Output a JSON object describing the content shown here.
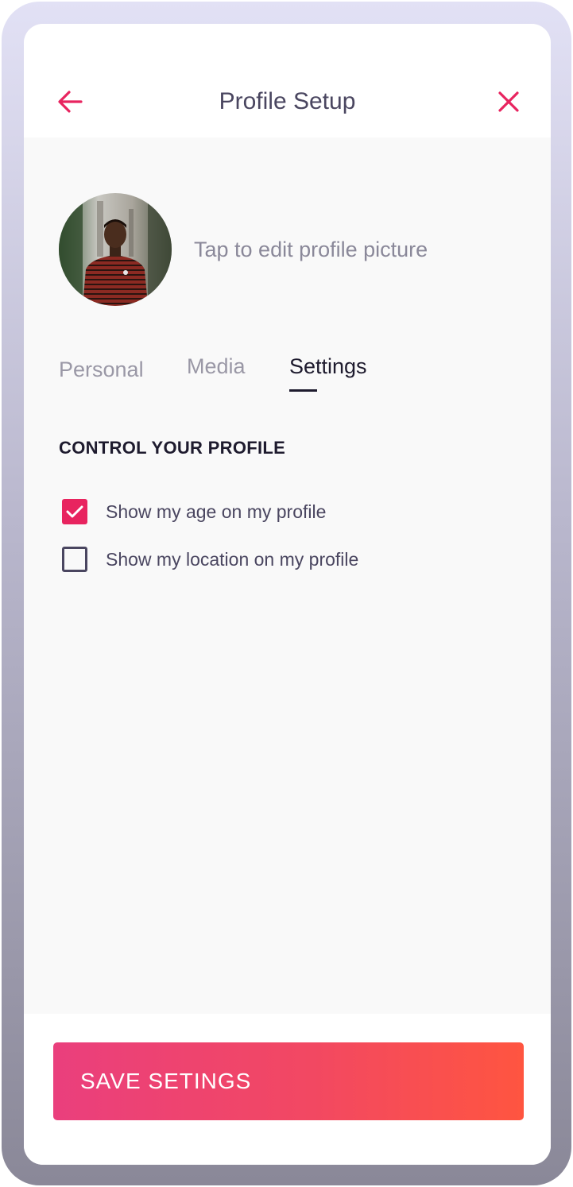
{
  "header": {
    "title": "Profile Setup",
    "back_icon": "arrow-left-icon",
    "close_icon": "close-icon"
  },
  "profile": {
    "avatar_icon": "avatar-photo",
    "edit_hint": "Tap to edit profile picture"
  },
  "tabs": [
    {
      "label": "Personal",
      "active": false
    },
    {
      "label": "Media",
      "active": false
    },
    {
      "label": "Settings",
      "active": true
    }
  ],
  "settings": {
    "heading": "CONTROL YOUR PROFILE",
    "options": [
      {
        "label": "Show my age on my profile",
        "checked": true
      },
      {
        "label": "Show my location on my profile",
        "checked": false
      }
    ]
  },
  "footer": {
    "save_label": "SAVE SETINGS"
  },
  "colors": {
    "accent": "#e8245f",
    "text_dark": "#1e1b2e",
    "text_muted": "#4a4660",
    "button_gradient_start": "#ea3f7d",
    "button_gradient_end": "#ff5540"
  }
}
